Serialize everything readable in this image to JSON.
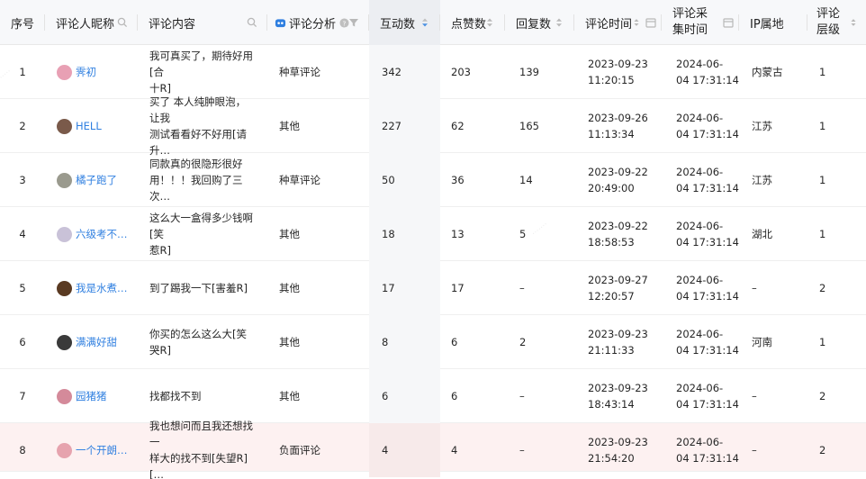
{
  "columns": {
    "index": "序号",
    "nickname": "评论人昵称",
    "content": "评论内容",
    "analysis": "评论分析",
    "interactions": "互动数",
    "likes": "点赞数",
    "replies": "回复数",
    "comment_time": "评论时间",
    "collect_time_l1": "评论采",
    "collect_time_l2": "集时间",
    "ip": "IP属地",
    "level_l1": "评论",
    "level_l2": "层级"
  },
  "rows": [
    {
      "index": "1",
      "nickname": "霁初",
      "content_l1": "我可真买了，期待好用[合",
      "content_l2": "十R]",
      "analysis": "种草评论",
      "interactions": "342",
      "likes": "203",
      "replies": "139",
      "ct_date": "2023-09-23",
      "ct_time": "11:20:15",
      "cl_date": "2024-06-",
      "cl_time": "04 17:31:14",
      "ip": "内蒙古",
      "level": "1",
      "avatar_color": "#e8a0b4"
    },
    {
      "index": "2",
      "nickname": "HELL",
      "content_l1": "买了 本人纯肿眼泡，让我",
      "content_l2": "测试看看好不好用[请升…",
      "analysis": "其他",
      "interactions": "227",
      "likes": "62",
      "replies": "165",
      "ct_date": "2023-09-26",
      "ct_time": "11:13:34",
      "cl_date": "2024-06-",
      "cl_time": "04 17:31:14",
      "ip": "江苏",
      "level": "1",
      "avatar_color": "#7a5a4a"
    },
    {
      "index": "3",
      "nickname": "橘子跑了",
      "content_l1": "同款真的很隐形很好",
      "content_l2": "用！！！我回购了三次…",
      "analysis": "种草评论",
      "interactions": "50",
      "likes": "36",
      "replies": "14",
      "ct_date": "2023-09-22",
      "ct_time": "20:49:00",
      "cl_date": "2024-06-",
      "cl_time": "04 17:31:14",
      "ip": "江苏",
      "level": "1",
      "avatar_color": "#9a9a8e"
    },
    {
      "index": "4",
      "nickname": "六级考不…",
      "content_l1": "这么大一盒得多少钱啊[笑",
      "content_l2": "惹R]",
      "analysis": "其他",
      "interactions": "18",
      "likes": "13",
      "replies": "5",
      "ct_date": "2023-09-22",
      "ct_time": "18:58:53",
      "cl_date": "2024-06-",
      "cl_time": "04 17:31:14",
      "ip": "湖北",
      "level": "1",
      "avatar_color": "#c9c2d8"
    },
    {
      "index": "5",
      "nickname": "我是水煮…",
      "content_l1": "到了踢我一下[害羞R]",
      "content_l2": "",
      "analysis": "其他",
      "interactions": "17",
      "likes": "17",
      "replies": "–",
      "ct_date": "2023-09-27",
      "ct_time": "12:20:57",
      "cl_date": "2024-06-",
      "cl_time": "04 17:31:14",
      "ip": "–",
      "level": "2",
      "avatar_color": "#5a3a22"
    },
    {
      "index": "6",
      "nickname": "满满好甜",
      "content_l1": "你买的怎么这么大[笑哭R]",
      "content_l2": "",
      "analysis": "其他",
      "interactions": "8",
      "likes": "6",
      "replies": "2",
      "ct_date": "2023-09-23",
      "ct_time": "21:11:33",
      "cl_date": "2024-06-",
      "cl_time": "04 17:31:14",
      "ip": "河南",
      "level": "1",
      "avatar_color": "#3a3a3a"
    },
    {
      "index": "7",
      "nickname": "园猪猪",
      "content_l1": "找都找不到",
      "content_l2": "",
      "analysis": "其他",
      "interactions": "6",
      "likes": "6",
      "replies": "–",
      "ct_date": "2023-09-23",
      "ct_time": "18:43:14",
      "cl_date": "2024-06-",
      "cl_time": "04 17:31:14",
      "ip": "–",
      "level": "2",
      "avatar_color": "#d48a9a"
    },
    {
      "index": "8",
      "nickname": "一个开朗…",
      "content_l1": "我也想问而且我还想找一",
      "content_l2": "样大的找不到[失望R][…",
      "analysis": "负面评论",
      "interactions": "4",
      "likes": "4",
      "replies": "–",
      "ct_date": "2023-09-23",
      "ct_time": "21:54:20",
      "cl_date": "2024-06-",
      "cl_time": "04 17:31:14",
      "ip": "–",
      "level": "2",
      "avatar_color": "#e6a3ae"
    }
  ],
  "colors": {
    "header_bg": "#f7f8fa",
    "link": "#2f7fe0",
    "highlight_row": "#fdf1f1",
    "sort_active": "#4a90e2"
  }
}
